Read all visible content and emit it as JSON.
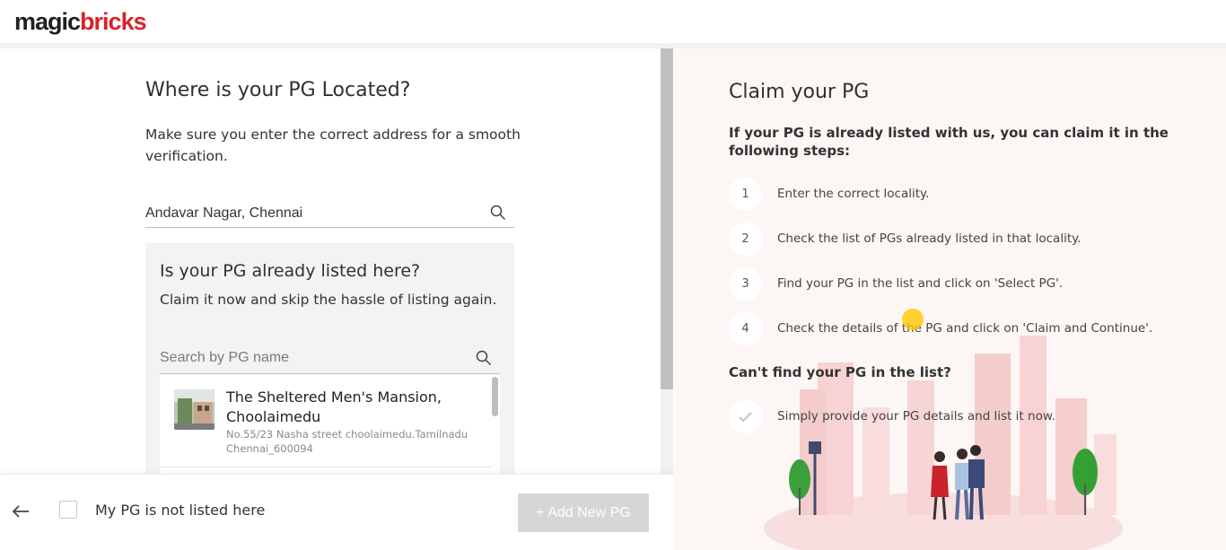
{
  "header": {
    "logo_part1": "magic",
    "logo_part2": "bricks",
    "brand_color": "#d8232a"
  },
  "left": {
    "title": "Where is your PG Located?",
    "subtitle": "Make sure you enter the correct address for a smooth verification.",
    "location_value": "Andavar Nagar, Chennai",
    "location_icon": "search-icon",
    "card": {
      "title": "Is your PG already listed here?",
      "subtitle": "Claim it now and skip the hassle of listing again.",
      "search_placeholder": "Search by PG name",
      "search_icon": "search-icon",
      "items": [
        {
          "name": "The Sheltered Men's Mansion, Choolaimedu",
          "address": "No.55/23 Nasha street choolaimedu.Tamilnadu Chennai_600094"
        }
      ]
    }
  },
  "bottom": {
    "back_icon": "arrow-left-icon",
    "checkbox_label": "My PG is not listed here",
    "add_button": "+ Add New PG"
  },
  "right": {
    "title": "Claim your PG",
    "subtitle": "If your PG is already listed with us, you can claim it in the following steps:",
    "steps": [
      {
        "num": "1",
        "text": "Enter the correct locality."
      },
      {
        "num": "2",
        "text": "Check the list of PGs already listed in that locality."
      },
      {
        "num": "3",
        "text": "Find your PG in the list and click on 'Select PG'."
      },
      {
        "num": "4",
        "text": "Check the details of the PG and click on 'Claim and Continue'."
      }
    ],
    "cant_find_title": "Can't find your PG in the list?",
    "cant_find_text": "Simply provide your PG details and list it now.",
    "cant_find_icon": "check-icon"
  }
}
